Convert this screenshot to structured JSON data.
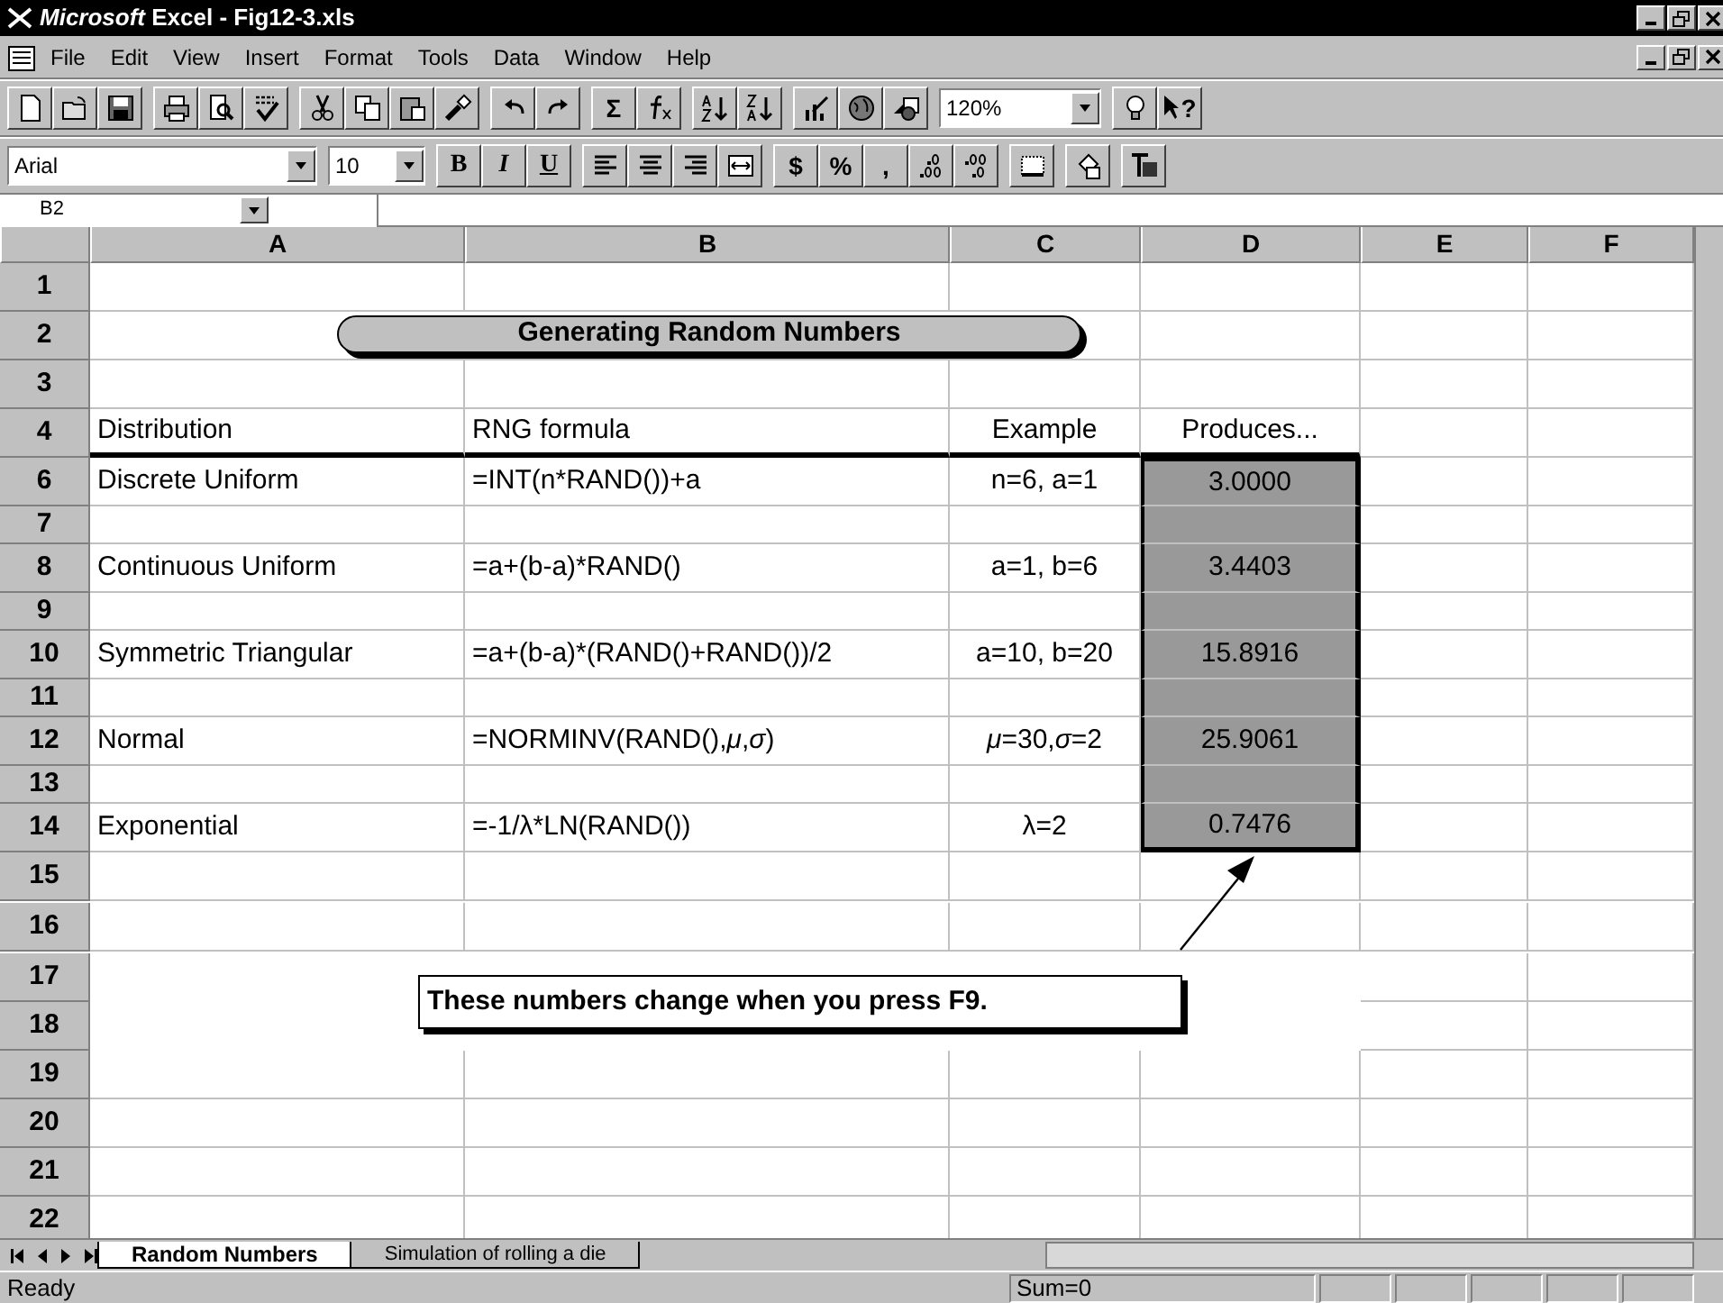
{
  "window": {
    "title": "*Microsoft* Excel - Fig12-3.xls"
  },
  "menu": [
    {
      "label": "File"
    },
    {
      "label": "Edit"
    },
    {
      "label": "View"
    },
    {
      "label": "Insert"
    },
    {
      "label": "Format"
    },
    {
      "label": "Tools"
    },
    {
      "label": "Data"
    },
    {
      "label": "Window"
    },
    {
      "label": "Help"
    }
  ],
  "standard_toolbar": {
    "sum_label": "Σ",
    "zoom": "120%",
    "help_label": "?"
  },
  "formatting_toolbar": {
    "font": "Arial",
    "size": "10",
    "bold_label": "B",
    "italic_label": "I",
    "underline_label": "U",
    "currency_label": "$",
    "percent_label": "%",
    "comma_label": ","
  },
  "name_box": {
    "value": "B2"
  },
  "columns": [
    {
      "label": "A"
    },
    {
      "label": "B"
    },
    {
      "label": "C"
    },
    {
      "label": "D"
    },
    {
      "label": "E"
    },
    {
      "label": "F"
    }
  ],
  "rows": [
    {
      "number": "1",
      "kind": "tall"
    },
    {
      "number": "2",
      "kind": "tall",
      "banner": {
        "text": "Generating Random Numbers"
      }
    },
    {
      "number": "3",
      "kind": "tall"
    },
    {
      "number": "4",
      "kind": "tall",
      "cell_a": {
        "text": "Distribution",
        "border_bottom": true
      },
      "cell_b": {
        "text": "RNG formula",
        "border_bottom": true
      },
      "cell_c": {
        "text": "Example",
        "border_bottom": true
      },
      "cell_d": {
        "text": "Produces...",
        "border_bottom": true
      }
    },
    {
      "number": "6",
      "kind": "tall",
      "cell_a": {
        "text": "Discrete Uniform"
      },
      "cell_b": {
        "text": "=INT(n*RAND())+a"
      },
      "cell_c": {
        "text": "n=6, a=1"
      },
      "cell_d": {
        "text": "3.0000",
        "shaded": true
      }
    },
    {
      "number": "7",
      "kind": "short",
      "cell_d": {
        "shaded": true
      }
    },
    {
      "number": "8",
      "kind": "tall",
      "cell_a": {
        "text": "Continuous Uniform"
      },
      "cell_b": {
        "text": "=a+(b-a)*RAND()"
      },
      "cell_c": {
        "text": "a=1, b=6"
      },
      "cell_d": {
        "text": "3.4403",
        "shaded": true
      }
    },
    {
      "number": "9",
      "kind": "short",
      "cell_d": {
        "shaded": true
      }
    },
    {
      "number": "10",
      "kind": "tall",
      "cell_a": {
        "text": "Symmetric Triangular"
      },
      "cell_b": {
        "text": "=a+(b-a)*(RAND()+RAND())/2"
      },
      "cell_c": {
        "text": "a=10, b=20"
      },
      "cell_d": {
        "text": "15.8916",
        "shaded": true
      }
    },
    {
      "number": "11",
      "kind": "short",
      "cell_d": {
        "shaded": true
      }
    },
    {
      "number": "12",
      "kind": "tall",
      "cell_a": {
        "text": "Normal"
      },
      "cell_b": {
        "text": "=NORMINV(RAND(),*μ*,*σ*)"
      },
      "cell_c": {
        "text": "*μ*=30,*σ*=2"
      },
      "cell_d": {
        "text": "25.9061",
        "shaded": true
      }
    },
    {
      "number": "13",
      "kind": "short",
      "cell_d": {
        "shaded": true
      }
    },
    {
      "number": "14",
      "kind": "tall",
      "cell_a": {
        "text": "Exponential"
      },
      "cell_b": {
        "text": "=-1/λ*LN(RAND())"
      },
      "cell_c": {
        "text": "λ=2"
      },
      "cell_d": {
        "text": "0.7476",
        "shaded": true
      }
    },
    {
      "number": "15",
      "kind": "tall"
    },
    {
      "number": "16",
      "kind": "tall"
    },
    {
      "number": "17",
      "kind": "tall",
      "callout": {
        "text": "These numbers change when you press F9."
      }
    },
    {
      "number": "18",
      "kind": "tall"
    },
    {
      "number": "19",
      "kind": "tall"
    },
    {
      "number": "20",
      "kind": "tall"
    },
    {
      "number": "21",
      "kind": "tall"
    },
    {
      "number": "22",
      "kind": "tall"
    }
  ],
  "sheet_tabs": [
    {
      "label": "Random Numbers",
      "selected": true
    },
    {
      "label": "Simulation of rolling a die",
      "selected": false
    }
  ],
  "status_bar": {
    "text": "Ready",
    "sum": "Sum=0"
  }
}
